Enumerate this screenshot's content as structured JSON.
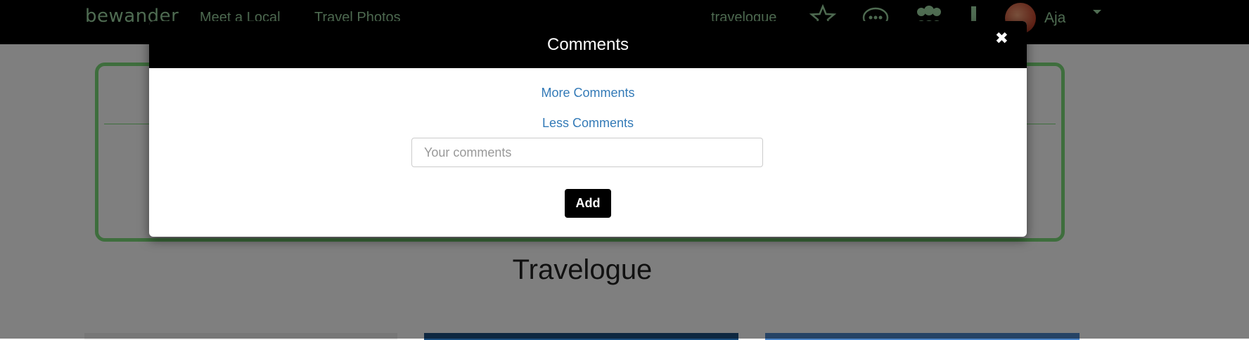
{
  "navbar": {
    "brand": "bewander",
    "links": [
      "Meet a Local",
      "Travel Photos",
      "travelogue"
    ],
    "user_name": "Aja",
    "icons": [
      "star-icon",
      "chat-bubble-icon",
      "group-icon",
      "alert-icon",
      "avatar",
      "dropdown-caret-icon"
    ]
  },
  "page": {
    "title": "Travelogue"
  },
  "modal": {
    "title": "Comments",
    "close_icon": "close-icon",
    "more_comments_label": "More Comments",
    "less_comments_label": "Less Comments",
    "comment_input": {
      "placeholder": "Your comments",
      "value": ""
    },
    "add_button_label": "Add"
  },
  "colors": {
    "navbar_bg": "#000000",
    "nav_text": "#9fd8a4",
    "card_border": "#7ddc7a",
    "link": "#337ab7",
    "modal_header_bg": "#000000",
    "button_bg": "#000000"
  }
}
